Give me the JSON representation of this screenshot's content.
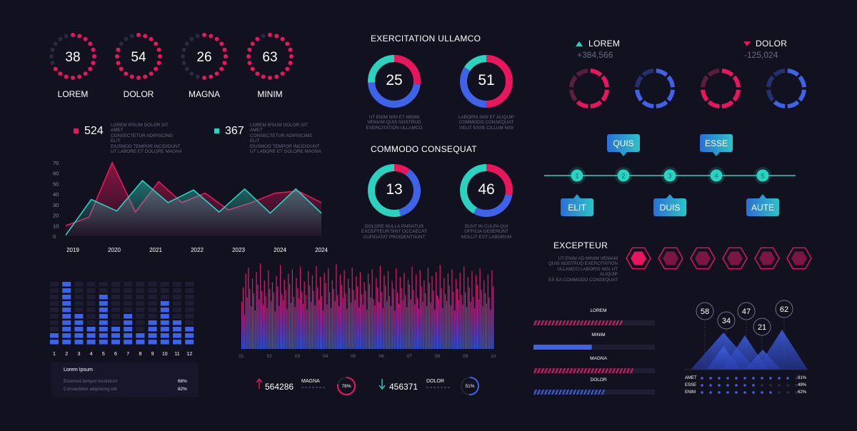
{
  "colors": {
    "pink": "#e8175d",
    "teal": "#2cd2c0",
    "blue": "#3f63e8",
    "purple": "#7a2a9c",
    "dim": "#2a2940"
  },
  "top_dials": [
    {
      "value": "38",
      "label": "LOREM",
      "fraction": 0.38
    },
    {
      "value": "54",
      "label": "DOLOR",
      "fraction": 0.54
    },
    {
      "value": "26",
      "label": "MAGNA",
      "fraction": 0.26
    },
    {
      "value": "63",
      "label": "MINIM",
      "fraction": 0.63
    }
  ],
  "legend": {
    "a_value": "524",
    "b_value": "367",
    "a_text": [
      "LOREM IPSUM DOLOR SIT AMET",
      "CONSECTETUR ADIPISCING ELIT",
      "EIUSMOD TEMPOR INCIDIDUNT",
      "UT LABORE ET DOLORE MAGNA"
    ],
    "b_text": [
      "LOREM IPSUM DOLOR SIT AMET",
      "CONSECTETUR ADIPISCING ELIT",
      "EIUSMOD TEMPOR INCIDIDUNT",
      "UT LABORE ET DOLORE MAGNA"
    ]
  },
  "donut_sections": [
    {
      "title": "EXERCITATION ULLAMCO"
    },
    {
      "title": "COMMODO CONSEQUAT"
    }
  ],
  "donuts": [
    {
      "value": "25",
      "text": [
        "UT ENIM NISI ET MINIM",
        "VENIAM QUIS NOSTRUD",
        "EXERCITATION ULLAMCO"
      ],
      "segments": [
        {
          "c": "pink",
          "f": 0.27
        },
        {
          "c": "blue",
          "f": 0.47
        },
        {
          "c": "teal",
          "f": 0.26
        }
      ]
    },
    {
      "value": "51",
      "text": [
        "LABORIS NISI ET ALIQUIP",
        "COMMODO CONSEQUAT",
        "VELIT ESSE CILLUM NISI"
      ],
      "segments": [
        {
          "c": "pink",
          "f": 0.5
        },
        {
          "c": "blue",
          "f": 0.34
        },
        {
          "c": "teal",
          "f": 0.16
        }
      ]
    },
    {
      "value": "13",
      "text": [
        "DOLORE NULLA PARIATUR",
        "EXCEPTEUR SINT OCCAECAT",
        "CUPIDATAT PROIDENTSUNT"
      ],
      "segments": [
        {
          "c": "pink",
          "f": 0.1
        },
        {
          "c": "blue",
          "f": 0.36
        },
        {
          "c": "teal",
          "f": 0.54
        }
      ]
    },
    {
      "value": "46",
      "text": [
        "SUNT IN CULPA QUI",
        "OFFICIA DESERUNT",
        "MOLLIT EST LABORUM"
      ],
      "segments": [
        {
          "c": "pink",
          "f": 0.28
        },
        {
          "c": "blue",
          "f": 0.3
        },
        {
          "c": "teal",
          "f": 0.42
        }
      ]
    }
  ],
  "indicators": [
    {
      "label": "LOREM",
      "value": "+384,566",
      "dir": "up"
    },
    {
      "label": "DOLOR",
      "value": "-125,024",
      "dir": "down"
    }
  ],
  "small_rings": [
    {
      "color": "pink",
      "lit": 5
    },
    {
      "color": "blue",
      "lit": 6
    },
    {
      "color": "pink",
      "lit": 6
    },
    {
      "color": "blue",
      "lit": 5
    }
  ],
  "timeline": {
    "steps": [
      "1",
      "2",
      "3",
      "4",
      "5"
    ],
    "top_tags": [
      {
        "label": "QUIS",
        "step": 1
      },
      {
        "label": "ESSE",
        "step": 3
      }
    ],
    "bottom_tags": [
      {
        "label": "ELIT",
        "step": 0
      },
      {
        "label": "DUIS",
        "step": 2
      },
      {
        "label": "AUTE",
        "step": 4
      }
    ]
  },
  "excepteur": {
    "title": "EXCEPTEUR",
    "text": [
      "UT ENIM AD MINIM VENIAM",
      "QUIS NOSTRUD EXERCITATION",
      "ULLAMCO LABORIS NISI UT ALIQUIP",
      "EX EA COMMODO CONSEQUAT"
    ]
  },
  "bottom_left_panel": {
    "title": "Lorem Ipsum",
    "rows": [
      {
        "label": "Eiusmod tempor incididunt",
        "value": "68%"
      },
      {
        "label": "Consectetur adipiscing elit",
        "value": "82%"
      }
    ]
  },
  "stats": [
    {
      "value": "564286",
      "label": "MAGNA",
      "pct": "78%",
      "fraction": 0.78,
      "dir": "up"
    },
    {
      "value": "456371",
      "label": "DOLOR",
      "pct": "51%",
      "fraction": 0.51,
      "dir": "down"
    }
  ],
  "progress_bars": [
    {
      "label": "LOREM",
      "fraction": 0.72,
      "style": "hatch-pink"
    },
    {
      "label": "MINIM",
      "fraction": 0.48,
      "style": "solid-blue"
    },
    {
      "label": "MAGNA",
      "fraction": 0.82,
      "style": "hatch-pink"
    },
    {
      "label": "DOLOR",
      "fraction": 0.58,
      "style": "hatch-blue"
    }
  ],
  "mountain": {
    "bubbles": [
      "58",
      "34",
      "47",
      "21",
      "62"
    ],
    "rows": [
      {
        "label": "AMET",
        "value": "81%",
        "dots": 11
      },
      {
        "label": "ESSE",
        "value": "49%",
        "dots": 7
      },
      {
        "label": "ENIM",
        "value": "62%",
        "dots": 9
      }
    ]
  },
  "chart_data": [
    {
      "type": "area",
      "x": [
        "2019",
        "2020",
        "2021",
        "2022",
        "2023",
        "2024",
        "2024"
      ],
      "ylim": [
        0,
        70
      ],
      "yticks": [
        "70",
        "60",
        "50",
        "40",
        "30",
        "20",
        "10",
        "0"
      ],
      "series": [
        {
          "name": "524",
          "values": [
            10,
            18,
            70,
            23,
            52,
            32,
            41,
            25,
            32,
            41,
            43,
            32
          ],
          "color": "pink"
        },
        {
          "name": "367",
          "values": [
            1,
            35,
            24,
            53,
            32,
            44,
            23,
            45,
            22,
            45,
            22
          ],
          "color": "teal"
        }
      ]
    },
    {
      "type": "bar",
      "categories": [
        "1",
        "2",
        "3",
        "4",
        "5",
        "6",
        "7",
        "8",
        "9",
        "10",
        "11",
        "12"
      ],
      "values": [
        2,
        10,
        5,
        3,
        8,
        3,
        5,
        2,
        4,
        7,
        4,
        3
      ],
      "ylim": [
        0,
        10
      ],
      "color": "blue"
    },
    {
      "type": "bar",
      "categories": [
        "01",
        "02",
        "03",
        "04",
        "05",
        "06",
        "07",
        "08",
        "09",
        "10"
      ],
      "values": [
        55,
        72,
        40,
        88,
        60,
        95,
        70,
        50,
        82,
        65,
        45,
        90,
        75,
        58,
        100,
        68,
        52,
        80,
        62,
        48,
        92,
        70,
        56,
        78,
        66,
        44,
        85,
        73,
        50,
        98,
        64,
        57,
        81,
        69,
        47,
        88,
        76,
        54,
        93,
        61,
        49,
        83,
        71,
        59,
        96,
        67,
        53,
        79,
        63,
        46,
        91,
        74,
        55,
        86,
        68,
        51,
        97,
        72,
        58,
        84,
        62,
        45,
        89,
        77,
        52,
        94,
        66,
        48,
        80,
        70,
        56,
        99,
        63,
        50,
        87,
        75,
        59,
        92,
        65,
        47,
        82,
        71,
        54,
        95,
        69,
        57,
        85,
        73,
        49,
        90,
        64,
        52,
        78,
        68,
        46,
        88,
        76,
        60,
        93,
        58,
        51,
        83,
        72,
        55,
        97,
        67,
        48,
        86,
        74,
        56,
        91,
        62,
        50,
        79,
        70,
        45,
        94,
        66,
        53,
        84,
        71,
        57,
        89,
        63,
        49,
        81,
        75,
        58,
        96,
        69,
        52,
        87,
        60,
        47,
        92,
        73,
        55,
        80,
        65,
        50,
        95,
        77,
        54,
        85,
        68,
        46,
        90,
        62,
        59,
        98,
        71,
        48,
        83,
        64,
        56,
        88,
        74,
        51,
        93,
        67,
        45,
        82,
        70,
        57,
        89,
        63,
        52,
        96,
        66,
        49,
        84,
        72,
        55,
        91,
        61,
        47,
        86,
        75,
        58,
        94,
        69,
        50,
        80,
        65,
        53,
        87,
        60,
        46,
        92,
        73
      ],
      "ylim": [
        0,
        100
      ]
    }
  ]
}
